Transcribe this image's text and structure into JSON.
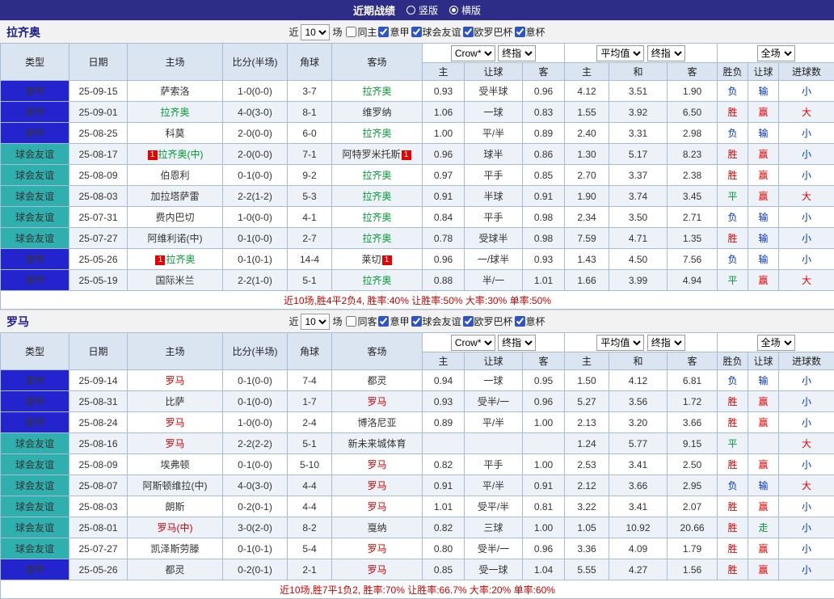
{
  "header": {
    "title": "近期战绩",
    "view_options": [
      {
        "label": "竖版",
        "selected": false
      },
      {
        "label": "横版",
        "selected": true
      }
    ]
  },
  "labels": {
    "near": "近",
    "matches": "场"
  },
  "selects": {
    "count": "10",
    "company": "Crow*",
    "final": "终指",
    "avg": "平均值",
    "final2": "终指",
    "scope": "全场"
  },
  "columns": {
    "type": "类型",
    "date": "日期",
    "home": "主场",
    "score": "比分(半场)",
    "corner": "角球",
    "away": "客场",
    "ah_home": "主",
    "ah_line": "让球",
    "ah_away": "客",
    "avg_home": "主",
    "avg_draw": "和",
    "avg_away": "客",
    "result": "胜负",
    "hc": "让球",
    "goals": "进球数"
  },
  "type_colors": {
    "意甲": "#2424cf",
    "球会友谊": "#2fafae"
  },
  "result_colors": {
    "胜": "#e60000",
    "平": "#009933",
    "负": "#0033cc"
  },
  "hc_colors": {
    "赢": "#e60000",
    "输": "#0033cc",
    "走": "#009933"
  },
  "goal_colors": {
    "大": "#e60000",
    "小": "#0033cc"
  },
  "sections": [
    {
      "team": "拉齐奥",
      "team_color": "#009933",
      "filters": [
        {
          "label": "同主",
          "checked": false
        },
        {
          "label": "意甲",
          "checked": true
        },
        {
          "label": "球会友谊",
          "checked": true
        },
        {
          "label": "欧罗巴杯",
          "checked": true
        },
        {
          "label": "意杯",
          "checked": true
        }
      ],
      "rows": [
        {
          "type": "意甲",
          "date": "25-09-15",
          "home": "萨索洛",
          "home_rc": 0,
          "score": "1-0(0-0)",
          "corner": "3-7",
          "away": "拉齐奥",
          "away_rc": 0,
          "ah_home": "0.93",
          "ah_line": "受半球",
          "ah_away": "0.96",
          "avg_home": "4.12",
          "avg_draw": "3.51",
          "avg_away": "1.90",
          "result": "负",
          "hc": "输",
          "goals": "小"
        },
        {
          "type": "意甲",
          "date": "25-09-01",
          "home": "拉齐奥",
          "home_rc": 0,
          "score": "4-0(3-0)",
          "corner": "8-1",
          "away": "维罗纳",
          "away_rc": 0,
          "ah_home": "1.06",
          "ah_line": "一球",
          "ah_away": "0.83",
          "avg_home": "1.55",
          "avg_draw": "3.92",
          "avg_away": "6.50",
          "result": "胜",
          "hc": "赢",
          "goals": "大"
        },
        {
          "type": "意甲",
          "date": "25-08-25",
          "home": "科莫",
          "home_rc": 0,
          "score": "2-0(0-0)",
          "corner": "6-0",
          "away": "拉齐奥",
          "away_rc": 0,
          "ah_home": "1.00",
          "ah_line": "平/半",
          "ah_away": "0.89",
          "avg_home": "2.40",
          "avg_draw": "3.31",
          "avg_away": "2.98",
          "result": "负",
          "hc": "输",
          "goals": "小"
        },
        {
          "type": "球会友谊",
          "date": "25-08-17",
          "home": "拉齐奥(中)",
          "home_rc": 1,
          "score": "2-0(0-0)",
          "corner": "7-1",
          "away": "阿特罗米托斯",
          "away_rc": 1,
          "ah_home": "0.96",
          "ah_line": "球半",
          "ah_away": "0.86",
          "avg_home": "1.30",
          "avg_draw": "5.17",
          "avg_away": "8.23",
          "result": "胜",
          "hc": "赢",
          "goals": "小"
        },
        {
          "type": "球会友谊",
          "date": "25-08-09",
          "home": "伯恩利",
          "home_rc": 0,
          "score": "0-1(0-0)",
          "corner": "9-2",
          "away": "拉齐奥",
          "away_rc": 0,
          "ah_home": "0.97",
          "ah_line": "平手",
          "ah_away": "0.85",
          "avg_home": "2.70",
          "avg_draw": "3.37",
          "avg_away": "2.38",
          "result": "胜",
          "hc": "赢",
          "goals": "小"
        },
        {
          "type": "球会友谊",
          "date": "25-08-03",
          "home": "加拉塔萨雷",
          "home_rc": 0,
          "score": "2-2(1-2)",
          "corner": "5-3",
          "away": "拉齐奥",
          "away_rc": 0,
          "ah_home": "0.91",
          "ah_line": "半球",
          "ah_away": "0.91",
          "avg_home": "1.90",
          "avg_draw": "3.74",
          "avg_away": "3.45",
          "result": "平",
          "hc": "赢",
          "goals": "大"
        },
        {
          "type": "球会友谊",
          "date": "25-07-31",
          "home": "费内巴切",
          "home_rc": 0,
          "score": "1-0(0-0)",
          "corner": "4-1",
          "away": "拉齐奥",
          "away_rc": 0,
          "ah_home": "0.84",
          "ah_line": "平手",
          "ah_away": "0.98",
          "avg_home": "2.34",
          "avg_draw": "3.50",
          "avg_away": "2.71",
          "result": "负",
          "hc": "输",
          "goals": "小"
        },
        {
          "type": "球会友谊",
          "date": "25-07-27",
          "home": "阿维利诺(中)",
          "home_rc": 0,
          "score": "0-1(0-0)",
          "corner": "2-7",
          "away": "拉齐奥",
          "away_rc": 0,
          "ah_home": "0.78",
          "ah_line": "受球半",
          "ah_away": "0.98",
          "avg_home": "7.59",
          "avg_draw": "4.71",
          "avg_away": "1.35",
          "result": "胜",
          "hc": "输",
          "goals": "小"
        },
        {
          "type": "意甲",
          "date": "25-05-26",
          "home": "拉齐奥",
          "home_rc": 1,
          "score": "0-1(0-1)",
          "corner": "14-4",
          "away": "莱切",
          "away_rc": 1,
          "ah_home": "0.96",
          "ah_line": "一/球半",
          "ah_away": "0.93",
          "avg_home": "1.43",
          "avg_draw": "4.50",
          "avg_away": "7.56",
          "result": "负",
          "hc": "输",
          "goals": "小"
        },
        {
          "type": "意甲",
          "date": "25-05-19",
          "home": "国际米兰",
          "home_rc": 0,
          "score": "2-2(1-0)",
          "corner": "5-1",
          "away": "拉齐奥",
          "away_rc": 0,
          "ah_home": "0.88",
          "ah_line": "半/一",
          "ah_away": "1.01",
          "avg_home": "1.66",
          "avg_draw": "3.99",
          "avg_away": "4.94",
          "result": "平",
          "hc": "赢",
          "goals": "大"
        }
      ],
      "summary": "近10场,胜4平2负4, 胜率:40% 让胜率:50% 大率:30% 单率:50%"
    },
    {
      "team": "罗马",
      "team_color": "#cc0000",
      "filters": [
        {
          "label": "同客",
          "checked": false
        },
        {
          "label": "意甲",
          "checked": true
        },
        {
          "label": "球会友谊",
          "checked": true
        },
        {
          "label": "欧罗巴杯",
          "checked": true
        },
        {
          "label": "意杯",
          "checked": true
        }
      ],
      "rows": [
        {
          "type": "意甲",
          "date": "25-09-14",
          "home": "罗马",
          "home_rc": 0,
          "score": "0-1(0-0)",
          "corner": "7-4",
          "away": "都灵",
          "away_rc": 0,
          "ah_home": "0.94",
          "ah_line": "一球",
          "ah_away": "0.95",
          "avg_home": "1.50",
          "avg_draw": "4.12",
          "avg_away": "6.81",
          "result": "负",
          "hc": "输",
          "goals": "小"
        },
        {
          "type": "意甲",
          "date": "25-08-31",
          "home": "比萨",
          "home_rc": 0,
          "score": "0-1(0-0)",
          "corner": "1-7",
          "away": "罗马",
          "away_rc": 0,
          "ah_home": "0.93",
          "ah_line": "受半/一",
          "ah_away": "0.96",
          "avg_home": "5.27",
          "avg_draw": "3.56",
          "avg_away": "1.72",
          "result": "胜",
          "hc": "赢",
          "goals": "小"
        },
        {
          "type": "意甲",
          "date": "25-08-24",
          "home": "罗马",
          "home_rc": 0,
          "score": "1-0(0-0)",
          "corner": "2-4",
          "away": "博洛尼亚",
          "away_rc": 0,
          "ah_home": "0.89",
          "ah_line": "平/半",
          "ah_away": "1.00",
          "avg_home": "2.13",
          "avg_draw": "3.20",
          "avg_away": "3.66",
          "result": "胜",
          "hc": "赢",
          "goals": "小"
        },
        {
          "type": "球会友谊",
          "date": "25-08-16",
          "home": "罗马",
          "home_rc": 0,
          "score": "2-2(2-2)",
          "corner": "5-1",
          "away": "新未来城体育",
          "away_rc": 0,
          "ah_home": "",
          "ah_line": "",
          "ah_away": "",
          "avg_home": "1.24",
          "avg_draw": "5.77",
          "avg_away": "9.15",
          "result": "平",
          "hc": "",
          "goals": "大"
        },
        {
          "type": "球会友谊",
          "date": "25-08-09",
          "home": "埃弗顿",
          "home_rc": 0,
          "score": "0-1(0-0)",
          "corner": "5-10",
          "away": "罗马",
          "away_rc": 0,
          "ah_home": "0.82",
          "ah_line": "平手",
          "ah_away": "1.00",
          "avg_home": "2.53",
          "avg_draw": "3.41",
          "avg_away": "2.50",
          "result": "胜",
          "hc": "赢",
          "goals": "小"
        },
        {
          "type": "球会友谊",
          "date": "25-08-07",
          "home": "阿斯顿维拉(中)",
          "home_rc": 0,
          "score": "4-0(3-0)",
          "corner": "4-4",
          "away": "罗马",
          "away_rc": 0,
          "ah_home": "0.91",
          "ah_line": "平/半",
          "ah_away": "0.91",
          "avg_home": "2.12",
          "avg_draw": "3.66",
          "avg_away": "2.95",
          "result": "负",
          "hc": "输",
          "goals": "大"
        },
        {
          "type": "球会友谊",
          "date": "25-08-03",
          "home": "朗斯",
          "home_rc": 0,
          "score": "0-2(0-1)",
          "corner": "4-4",
          "away": "罗马",
          "away_rc": 0,
          "ah_home": "1.01",
          "ah_line": "受平/半",
          "ah_away": "0.81",
          "avg_home": "3.22",
          "avg_draw": "3.41",
          "avg_away": "2.07",
          "result": "胜",
          "hc": "赢",
          "goals": "小"
        },
        {
          "type": "球会友谊",
          "date": "25-08-01",
          "home": "罗马(中)",
          "home_rc": 0,
          "score": "3-0(2-0)",
          "corner": "8-2",
          "away": "戛纳",
          "away_rc": 0,
          "ah_home": "0.82",
          "ah_line": "三球",
          "ah_away": "1.00",
          "avg_home": "1.05",
          "avg_draw": "10.92",
          "avg_away": "20.66",
          "result": "胜",
          "hc": "走",
          "goals": "小"
        },
        {
          "type": "球会友谊",
          "date": "25-07-27",
          "home": "凯泽斯劳滕",
          "home_rc": 0,
          "score": "0-1(0-1)",
          "corner": "5-4",
          "away": "罗马",
          "away_rc": 0,
          "ah_home": "0.80",
          "ah_line": "受半/一",
          "ah_away": "0.96",
          "avg_home": "3.36",
          "avg_draw": "4.09",
          "avg_away": "1.79",
          "result": "胜",
          "hc": "赢",
          "goals": "小"
        },
        {
          "type": "意甲",
          "date": "25-05-26",
          "home": "都灵",
          "home_rc": 0,
          "score": "0-2(0-1)",
          "corner": "2-1",
          "away": "罗马",
          "away_rc": 0,
          "ah_home": "0.85",
          "ah_line": "受一球",
          "ah_away": "1.04",
          "avg_home": "5.55",
          "avg_draw": "4.27",
          "avg_away": "1.56",
          "result": "胜",
          "hc": "赢",
          "goals": "小"
        }
      ],
      "summary": "近10场,胜7平1负2, 胜率:70% 让胜率:66.7% 大率:20% 单率:60%"
    }
  ]
}
